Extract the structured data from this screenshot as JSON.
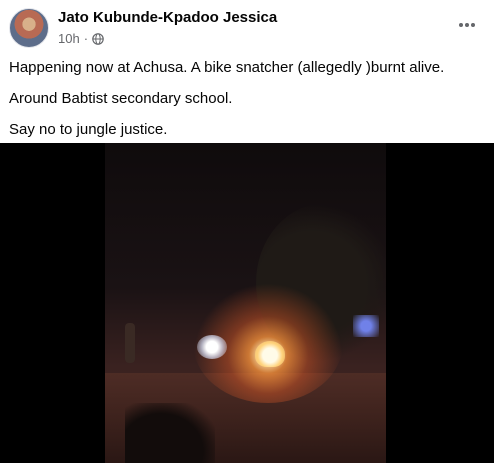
{
  "post": {
    "author": "Jato Kubunde-Kpadoo Jessica",
    "time": "10h",
    "separator": "·",
    "audience_icon": "globe-icon",
    "more_icon": "more-horizontal-icon",
    "lines": [
      "Happening now at Achusa.  A bike snatcher (allegedly )burnt alive.",
      "Around Babtist secondary school.",
      "Say no to jungle justice."
    ]
  },
  "colors": {
    "author_text": "#050505",
    "meta_text": "#65676b",
    "video_bg": "#000000"
  }
}
